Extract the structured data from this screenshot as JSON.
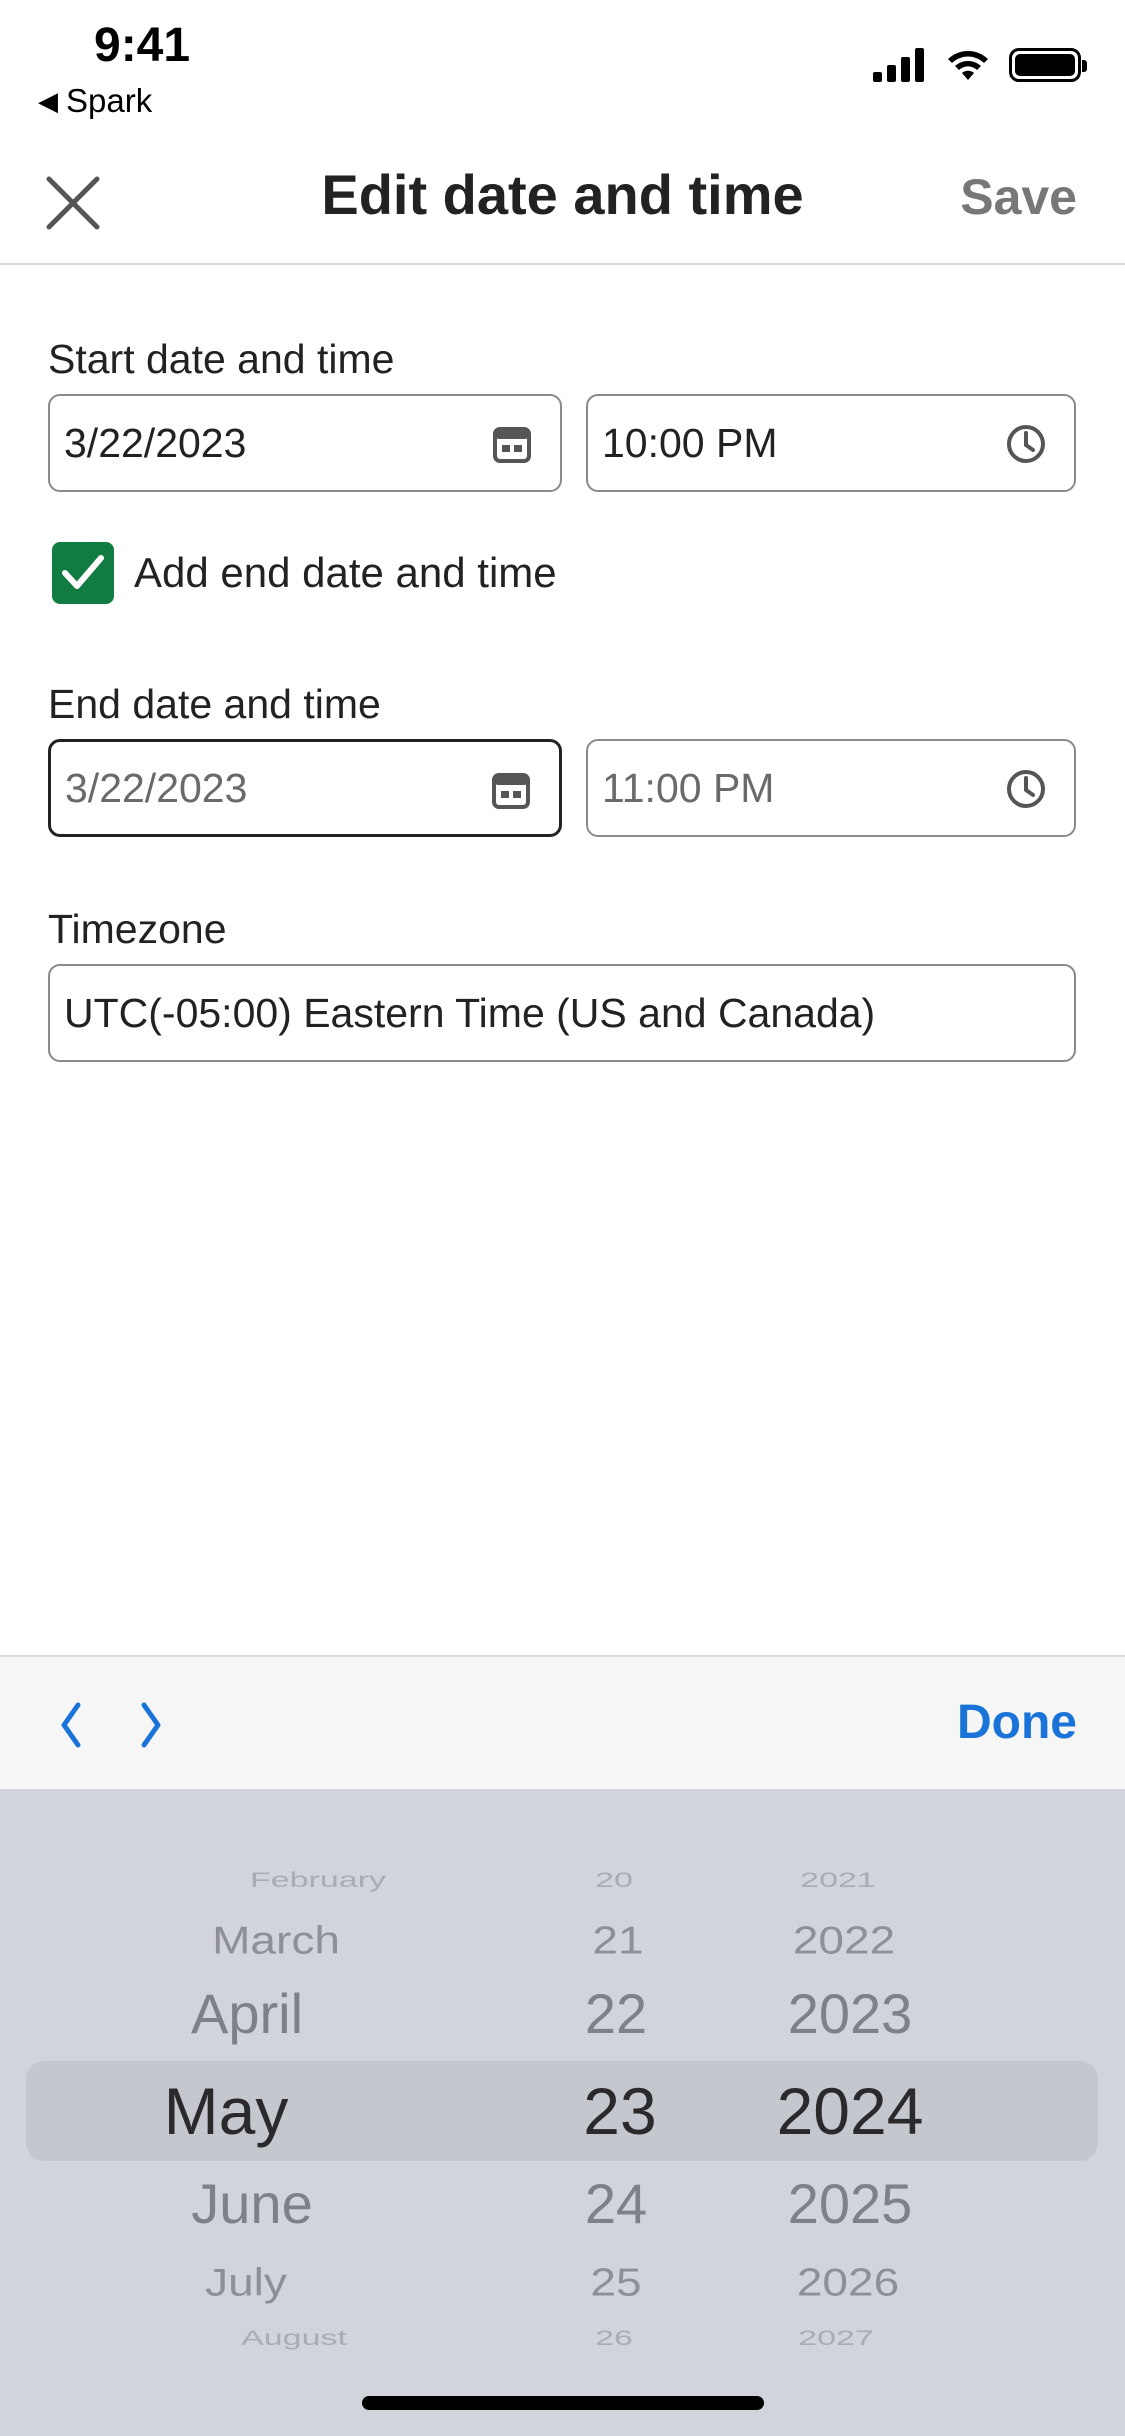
{
  "status_bar": {
    "time": "9:41",
    "back_app": "Spark",
    "back_icon": "back-triangle-icon"
  },
  "header": {
    "title": "Edit date and time",
    "save_label": "Save",
    "close_icon": "close-icon"
  },
  "form": {
    "start": {
      "label": "Start date and time",
      "date": "3/22/2023",
      "time": "10:00 PM"
    },
    "end_toggle": {
      "label": "Add end date and time",
      "checked": true,
      "accent": "#107c41"
    },
    "end": {
      "label": "End date and time",
      "date": "3/22/2023",
      "time": "11:00 PM"
    },
    "timezone": {
      "label": "Timezone",
      "value": "UTC(-05:00) Eastern Time (US and Canada)"
    }
  },
  "keyboard_toolbar": {
    "done_label": "Done",
    "prev_icon": "chevron-left-icon",
    "next_icon": "chevron-right-icon",
    "accent": "#1a73d8"
  },
  "picker": {
    "months": [
      "February",
      "March",
      "April",
      "May",
      "June",
      "July",
      "August"
    ],
    "days": [
      "20",
      "21",
      "22",
      "23",
      "24",
      "25",
      "26"
    ],
    "years": [
      "2021",
      "2022",
      "2023",
      "2024",
      "2025",
      "2026",
      "2027"
    ],
    "selected": {
      "month": "May",
      "day": "23",
      "year": "2024"
    }
  }
}
